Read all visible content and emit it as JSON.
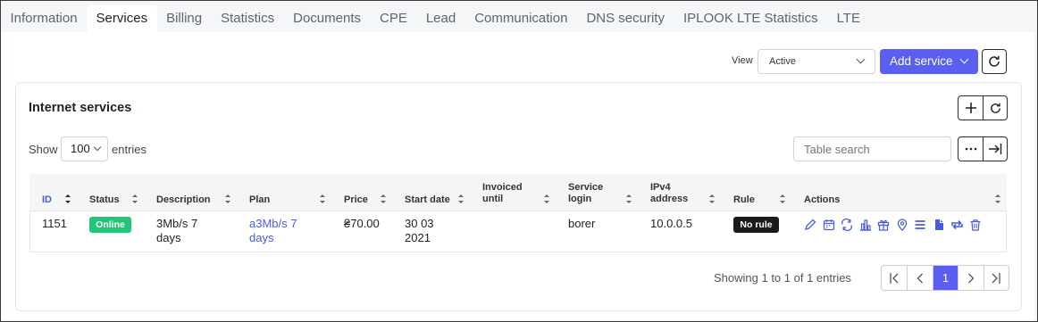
{
  "tabs": [
    {
      "label": "Information",
      "active": false
    },
    {
      "label": "Services",
      "active": true
    },
    {
      "label": "Billing",
      "active": false
    },
    {
      "label": "Statistics",
      "active": false
    },
    {
      "label": "Documents",
      "active": false
    },
    {
      "label": "CPE",
      "active": false
    },
    {
      "label": "Lead",
      "active": false
    },
    {
      "label": "Communication",
      "active": false
    },
    {
      "label": "DNS security",
      "active": false
    },
    {
      "label": "IPLOOK LTE Statistics",
      "active": false
    },
    {
      "label": "LTE",
      "active": false
    }
  ],
  "toolbar": {
    "view_label": "View",
    "view_value": "Active",
    "add_service_label": "Add service"
  },
  "card": {
    "title": "Internet services",
    "show_label": "Show",
    "entries_value": "100",
    "entries_label": "entries",
    "search_placeholder": "Table search"
  },
  "table": {
    "columns": {
      "id": "ID",
      "status": "Status",
      "description": "Description",
      "plan": "Plan",
      "price": "Price",
      "start_date": "Start date",
      "invoiced_until_1": "Invoiced",
      "invoiced_until_2": "until",
      "service_login_1": "Service",
      "service_login_2": "login",
      "ipv4_1": "IPv4",
      "ipv4_2": "address",
      "rule": "Rule",
      "actions": "Actions"
    },
    "rows": [
      {
        "id": "1151",
        "status": "Online",
        "description_1": "3Mb/s 7",
        "description_2": "days",
        "plan_1": "a3Mb/s 7",
        "plan_2": "days",
        "price": "₴70.00",
        "start_date_1": "30 03",
        "start_date_2": "2021",
        "invoiced_until": "",
        "service_login": "borer",
        "ipv4": "10.0.0.5",
        "rule": "No rule"
      }
    ]
  },
  "footer": {
    "showing": "Showing 1 to 1 of 1 entries",
    "current_page": "1"
  },
  "colors": {
    "primary": "#5a5ff1",
    "online": "#20c77a",
    "link": "#4a5cdb"
  }
}
